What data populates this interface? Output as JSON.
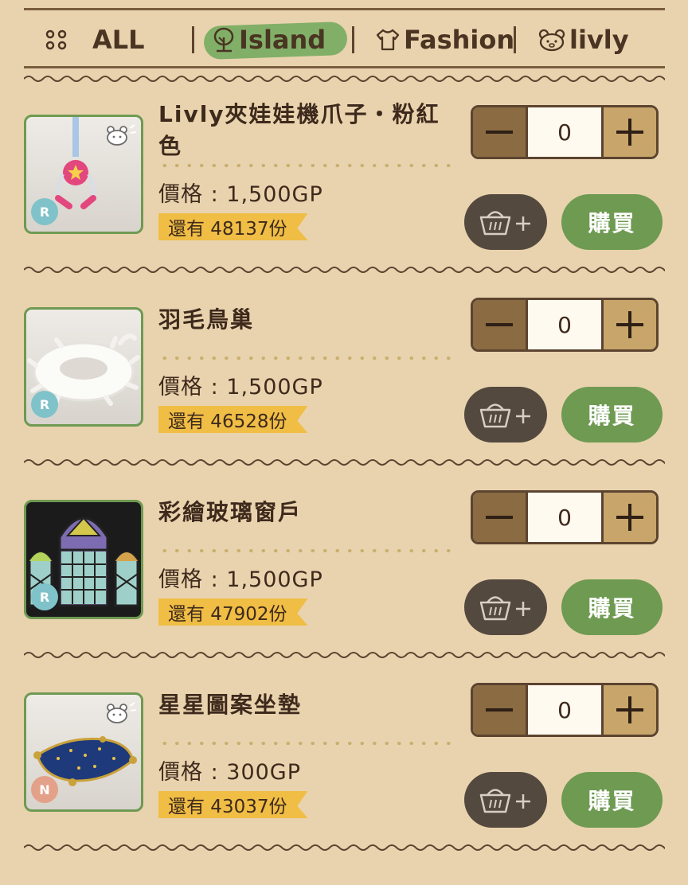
{
  "tabs": [
    {
      "label": "ALL",
      "icon": "grid-dots-icon"
    },
    {
      "label": "Island",
      "icon": "tree-icon",
      "selected": true
    },
    {
      "label": "Fashion",
      "icon": "shirt-icon"
    },
    {
      "label": "livly",
      "icon": "livly-face-icon"
    }
  ],
  "colors": {
    "background": "#e9d3ae",
    "accent_green": "#6e9a52",
    "stock_yellow": "#f0bd45",
    "dark_brown": "#4a3422",
    "rarity_R": "#7fc2c9",
    "rarity_N": "#e3a189"
  },
  "items": [
    {
      "name": "Livly夾娃娃機爪子・粉紅色",
      "price": "價格 : 1,500GP",
      "stock": "還有 48137份",
      "rarity": "R",
      "quantity": "0",
      "buy_label": "購買",
      "has_livly_mark": true,
      "image": "pink-claw-machine"
    },
    {
      "name": "羽毛鳥巢",
      "price": "價格 : 1,500GP",
      "stock": "還有 46528份",
      "rarity": "R",
      "quantity": "0",
      "buy_label": "購買",
      "has_livly_mark": false,
      "image": "feather-nest"
    },
    {
      "name": "彩繪玻璃窗戶",
      "price": "價格 : 1,500GP",
      "stock": "還有 47902份",
      "rarity": "R",
      "quantity": "0",
      "buy_label": "購買",
      "has_livly_mark": false,
      "image": "stained-glass-window"
    },
    {
      "name": "星星圖案坐墊",
      "price": "價格 : 300GP",
      "stock": "還有 43037份",
      "rarity": "N",
      "quantity": "0",
      "buy_label": "購買",
      "has_livly_mark": true,
      "image": "star-cushion"
    }
  ]
}
